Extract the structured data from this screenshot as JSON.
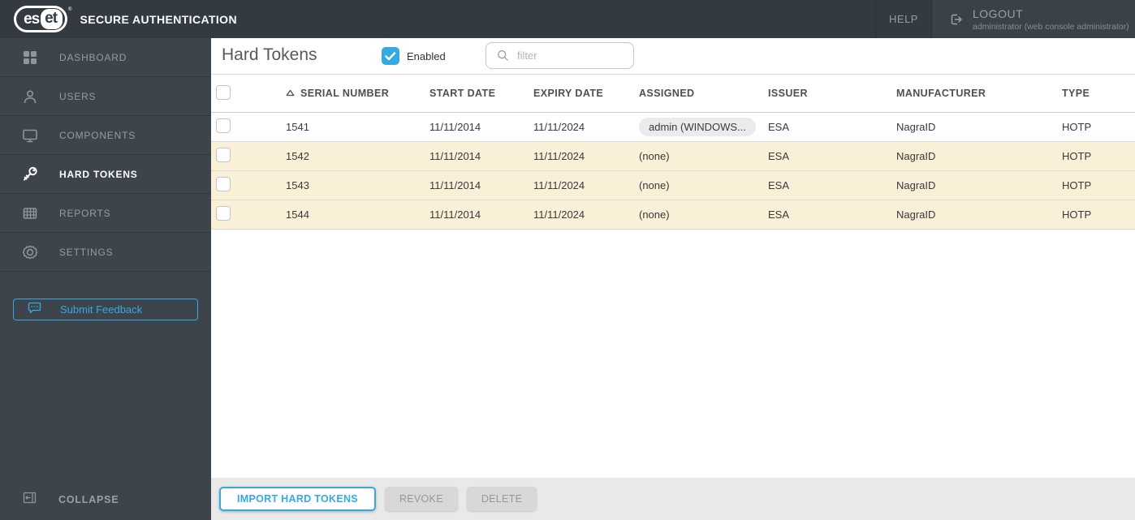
{
  "topbar": {
    "logo_text_outline": "es",
    "logo_text_box": "et",
    "logo_reg_mark": "®",
    "app_title": "SECURE AUTHENTICATION",
    "help_label": "HELP",
    "logout_label": "LOGOUT",
    "logout_user": "administrator (web console administrator)"
  },
  "sidebar": {
    "items": [
      {
        "label": "DASHBOARD",
        "icon": "dashboard-grid-icon",
        "active": false
      },
      {
        "label": "USERS",
        "icon": "user-icon",
        "active": false
      },
      {
        "label": "COMPONENTS",
        "icon": "monitor-icon",
        "active": false
      },
      {
        "label": "HARD TOKENS",
        "icon": "key-icon",
        "active": true
      },
      {
        "label": "REPORTS",
        "icon": "report-table-icon",
        "active": false
      },
      {
        "label": "SETTINGS",
        "icon": "gear-icon",
        "active": false
      }
    ],
    "feedback_label": "Submit Feedback",
    "collapse_label": "COLLAPSE"
  },
  "header": {
    "title": "Hard Tokens",
    "enabled_label": "Enabled",
    "enabled_checked": true,
    "filter_placeholder": "filter"
  },
  "table": {
    "columns": [
      "SERIAL NUMBER",
      "START DATE",
      "EXPIRY DATE",
      "ASSIGNED",
      "ISSUER",
      "MANUFACTURER",
      "TYPE"
    ],
    "sort_column": "SERIAL NUMBER",
    "sort_direction": "asc",
    "rows": [
      {
        "serial": "1541",
        "start": "11/11/2014",
        "expiry": "11/11/2024",
        "assigned": "admin (WINDOWS...",
        "assigned_badge": true,
        "issuer": "ESA",
        "manufacturer": "NagraID",
        "type": "HOTP",
        "highlighted": false
      },
      {
        "serial": "1542",
        "start": "11/11/2014",
        "expiry": "11/11/2024",
        "assigned": "(none)",
        "assigned_badge": false,
        "issuer": "ESA",
        "manufacturer": "NagraID",
        "type": "HOTP",
        "highlighted": true
      },
      {
        "serial": "1543",
        "start": "11/11/2014",
        "expiry": "11/11/2024",
        "assigned": "(none)",
        "assigned_badge": false,
        "issuer": "ESA",
        "manufacturer": "NagraID",
        "type": "HOTP",
        "highlighted": true
      },
      {
        "serial": "1544",
        "start": "11/11/2014",
        "expiry": "11/11/2024",
        "assigned": "(none)",
        "assigned_badge": false,
        "issuer": "ESA",
        "manufacturer": "NagraID",
        "type": "HOTP",
        "highlighted": true
      }
    ]
  },
  "footer": {
    "import_label": "IMPORT HARD TOKENS",
    "revoke_label": "REVOKE",
    "delete_label": "DELETE"
  },
  "colors": {
    "accent": "#36a9e1",
    "row-highlight": "#faf0d8",
    "topbar-bg": "#343a42",
    "sidebar-bg": "#3d444b",
    "footer-bg": "#e9e9e9"
  }
}
